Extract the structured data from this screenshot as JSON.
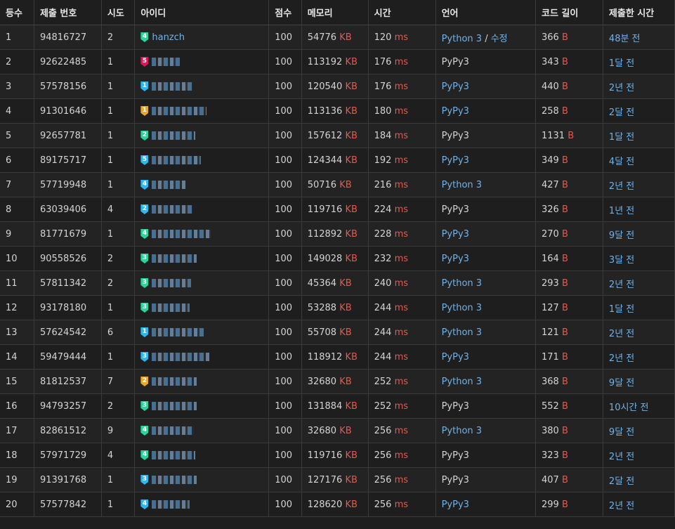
{
  "headers": [
    "등수",
    "제출 번호",
    "시도",
    "아이디",
    "점수",
    "메모리",
    "시간",
    "언어",
    "코드 길이",
    "제출한 시간"
  ],
  "units": {
    "memory": "KB",
    "time": "ms",
    "length": "B"
  },
  "edit_label": "수정",
  "rows": [
    {
      "rank": "1",
      "sub": "94816727",
      "tries": "2",
      "tier": "4",
      "tierClass": "t-plat",
      "user": "hanzch",
      "score": "100",
      "mem": "54776",
      "time": "120",
      "lang": "Python 3",
      "langLink": true,
      "edit": true,
      "len": "366",
      "when": "48분 전"
    },
    {
      "rank": "2",
      "sub": "92622485",
      "tries": "1",
      "tier": "5",
      "tierClass": "t-ruby",
      "user": "",
      "score": "100",
      "mem": "113192",
      "time": "176",
      "lang": "PyPy3",
      "langLink": false,
      "edit": false,
      "len": "343",
      "when": "1달 전"
    },
    {
      "rank": "3",
      "sub": "57578156",
      "tries": "1",
      "tier": "1",
      "tierClass": "t-dia",
      "user": "",
      "score": "100",
      "mem": "120540",
      "time": "176",
      "lang": "PyPy3",
      "langLink": true,
      "edit": false,
      "len": "440",
      "when": "2년 전"
    },
    {
      "rank": "4",
      "sub": "91301646",
      "tries": "1",
      "tier": "1",
      "tierClass": "t-gold",
      "user": "",
      "score": "100",
      "mem": "113136",
      "time": "180",
      "lang": "PyPy3",
      "langLink": true,
      "edit": false,
      "len": "258",
      "when": "2달 전"
    },
    {
      "rank": "5",
      "sub": "92657781",
      "tries": "1",
      "tier": "2",
      "tierClass": "t-plat",
      "user": "",
      "score": "100",
      "mem": "157612",
      "time": "184",
      "lang": "PyPy3",
      "langLink": false,
      "edit": false,
      "len": "1131",
      "when": "1달 전"
    },
    {
      "rank": "6",
      "sub": "89175717",
      "tries": "1",
      "tier": "5",
      "tierClass": "t-dia",
      "user": "",
      "score": "100",
      "mem": "124344",
      "time": "192",
      "lang": "PyPy3",
      "langLink": true,
      "edit": false,
      "len": "349",
      "when": "4달 전"
    },
    {
      "rank": "7",
      "sub": "57719948",
      "tries": "1",
      "tier": "4",
      "tierClass": "t-dia",
      "user": "",
      "score": "100",
      "mem": "50716",
      "time": "216",
      "lang": "Python 3",
      "langLink": true,
      "edit": false,
      "len": "427",
      "when": "2년 전"
    },
    {
      "rank": "8",
      "sub": "63039406",
      "tries": "4",
      "tier": "2",
      "tierClass": "t-dia",
      "user": "",
      "score": "100",
      "mem": "119716",
      "time": "224",
      "lang": "PyPy3",
      "langLink": false,
      "edit": false,
      "len": "326",
      "when": "1년 전"
    },
    {
      "rank": "9",
      "sub": "81771679",
      "tries": "1",
      "tier": "4",
      "tierClass": "t-plat",
      "user": "",
      "score": "100",
      "mem": "112892",
      "time": "228",
      "lang": "PyPy3",
      "langLink": true,
      "edit": false,
      "len": "270",
      "when": "9달 전"
    },
    {
      "rank": "10",
      "sub": "90558526",
      "tries": "2",
      "tier": "3",
      "tierClass": "t-plat",
      "user": "",
      "score": "100",
      "mem": "149028",
      "time": "232",
      "lang": "PyPy3",
      "langLink": true,
      "edit": false,
      "len": "164",
      "when": "3달 전"
    },
    {
      "rank": "11",
      "sub": "57811342",
      "tries": "2",
      "tier": "3",
      "tierClass": "t-plat",
      "user": "",
      "score": "100",
      "mem": "45364",
      "time": "240",
      "lang": "Python 3",
      "langLink": true,
      "edit": false,
      "len": "293",
      "when": "2년 전"
    },
    {
      "rank": "12",
      "sub": "93178180",
      "tries": "1",
      "tier": "3",
      "tierClass": "t-plat",
      "user": "",
      "score": "100",
      "mem": "53288",
      "time": "244",
      "lang": "Python 3",
      "langLink": true,
      "edit": false,
      "len": "127",
      "when": "1달 전"
    },
    {
      "rank": "13",
      "sub": "57624542",
      "tries": "6",
      "tier": "1",
      "tierClass": "t-dia",
      "user": "",
      "score": "100",
      "mem": "55708",
      "time": "244",
      "lang": "Python 3",
      "langLink": true,
      "edit": false,
      "len": "121",
      "when": "2년 전"
    },
    {
      "rank": "14",
      "sub": "59479444",
      "tries": "1",
      "tier": "3",
      "tierClass": "t-dia",
      "user": "",
      "score": "100",
      "mem": "118912",
      "time": "244",
      "lang": "PyPy3",
      "langLink": true,
      "edit": false,
      "len": "171",
      "when": "2년 전"
    },
    {
      "rank": "15",
      "sub": "81812537",
      "tries": "7",
      "tier": "2",
      "tierClass": "t-gold",
      "user": "",
      "score": "100",
      "mem": "32680",
      "time": "252",
      "lang": "Python 3",
      "langLink": true,
      "edit": false,
      "len": "368",
      "when": "9달 전"
    },
    {
      "rank": "16",
      "sub": "94793257",
      "tries": "2",
      "tier": "3",
      "tierClass": "t-plat",
      "user": "",
      "score": "100",
      "mem": "131884",
      "time": "252",
      "lang": "PyPy3",
      "langLink": false,
      "edit": false,
      "len": "552",
      "when": "10시간 전"
    },
    {
      "rank": "17",
      "sub": "82861512",
      "tries": "9",
      "tier": "4",
      "tierClass": "t-plat",
      "user": "",
      "score": "100",
      "mem": "32680",
      "time": "256",
      "lang": "Python 3",
      "langLink": true,
      "edit": false,
      "len": "380",
      "when": "9달 전"
    },
    {
      "rank": "18",
      "sub": "57971729",
      "tries": "4",
      "tier": "4",
      "tierClass": "t-plat",
      "user": "",
      "score": "100",
      "mem": "119716",
      "time": "256",
      "lang": "PyPy3",
      "langLink": false,
      "edit": false,
      "len": "323",
      "when": "2년 전"
    },
    {
      "rank": "19",
      "sub": "91391768",
      "tries": "1",
      "tier": "3",
      "tierClass": "t-dia",
      "user": "",
      "score": "100",
      "mem": "127176",
      "time": "256",
      "lang": "PyPy3",
      "langLink": false,
      "edit": false,
      "len": "407",
      "when": "2달 전"
    },
    {
      "rank": "20",
      "sub": "57577842",
      "tries": "1",
      "tier": "4",
      "tierClass": "t-dia",
      "user": "",
      "score": "100",
      "mem": "128620",
      "time": "256",
      "lang": "PyPy3",
      "langLink": true,
      "edit": false,
      "len": "299",
      "when": "2년 전"
    }
  ]
}
